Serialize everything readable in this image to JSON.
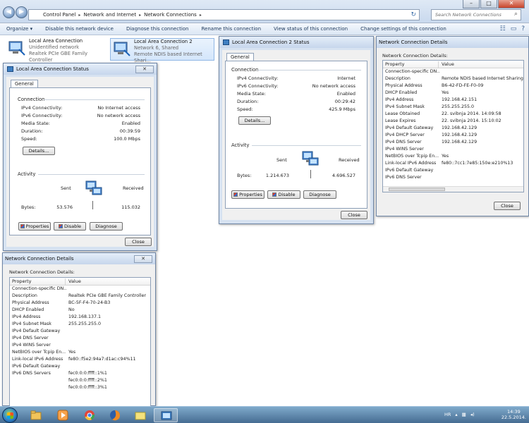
{
  "explorer": {
    "breadcrumb": [
      "Control Panel",
      "Network and Internet",
      "Network Connections"
    ],
    "search_placeholder": "Search Network Connections",
    "commands": [
      "Organize ▾",
      "Disable this network device",
      "Diagnose this connection",
      "Rename this connection",
      "View status of this connection",
      "Change settings of this connection"
    ],
    "connections": [
      {
        "name": "Local Area Connection",
        "status": "Unidentified network",
        "device": "Realtek PCIe GBE Family Controller"
      },
      {
        "name": "Local Area Connection 2",
        "status": "Network 6, Shared",
        "device": "Remote NDIS based Internet Shari..."
      }
    ]
  },
  "status1": {
    "title": "Local Area Connection Status",
    "tab": "General",
    "connection_label": "Connection",
    "rows": [
      {
        "label": "IPv4 Connectivity:",
        "value": "No Internet access"
      },
      {
        "label": "IPv6 Connectivity:",
        "value": "No network access"
      },
      {
        "label": "Media State:",
        "value": "Enabled"
      },
      {
        "label": "Duration:",
        "value": "00:39:59"
      },
      {
        "label": "Speed:",
        "value": "100.0 Mbps"
      }
    ],
    "details_button": "Details...",
    "activity_label": "Activity",
    "sent_label": "Sent",
    "received_label": "Received",
    "bytes_label": "Bytes:",
    "bytes_sent": "53.576",
    "bytes_received": "115.032",
    "buttons": [
      "Properties",
      "Disable",
      "Diagnose"
    ],
    "close": "Close"
  },
  "status2": {
    "title": "Local Area Connection 2 Status",
    "tab": "General",
    "connection_label": "Connection",
    "rows": [
      {
        "label": "IPv4 Connectivity:",
        "value": "Internet"
      },
      {
        "label": "IPv6 Connectivity:",
        "value": "No network access"
      },
      {
        "label": "Media State:",
        "value": "Enabled"
      },
      {
        "label": "Duration:",
        "value": "00:29:42"
      },
      {
        "label": "Speed:",
        "value": "425.9 Mbps"
      }
    ],
    "details_button": "Details...",
    "activity_label": "Activity",
    "sent_label": "Sent",
    "received_label": "Received",
    "bytes_label": "Bytes:",
    "bytes_sent": "1.214.673",
    "bytes_received": "4.696.527",
    "buttons": [
      "Properties",
      "Disable",
      "Diagnose"
    ],
    "close": "Close"
  },
  "details1": {
    "title": "Network Connection Details",
    "caption": "Network Connection Details:",
    "col_property": "Property",
    "col_value": "Value",
    "rows": [
      {
        "p": "Connection-specific DN...",
        "v": ""
      },
      {
        "p": "Description",
        "v": "Realtek PCIe GBE Family Controller"
      },
      {
        "p": "Physical Address",
        "v": "BC-5F-F4-70-24-B3"
      },
      {
        "p": "DHCP Enabled",
        "v": "No"
      },
      {
        "p": "IPv4 Address",
        "v": "192.168.137.1"
      },
      {
        "p": "IPv4 Subnet Mask",
        "v": "255.255.255.0"
      },
      {
        "p": "IPv4 Default Gateway",
        "v": ""
      },
      {
        "p": "IPv4 DNS Server",
        "v": ""
      },
      {
        "p": "IPv4 WINS Server",
        "v": ""
      },
      {
        "p": "NetBIOS over Tcpip En...",
        "v": "Yes"
      },
      {
        "p": "Link-local IPv6 Address",
        "v": "fe80::f5e2:94a7:d1ac:c94%11"
      },
      {
        "p": "IPv6 Default Gateway",
        "v": ""
      },
      {
        "p": "IPv6 DNS Servers",
        "v": "fec0:0:0:ffff::1%1"
      },
      {
        "p": "",
        "v": "fec0:0:0:ffff::2%1"
      },
      {
        "p": "",
        "v": "fec0:0:0:ffff::3%1"
      }
    ]
  },
  "details2": {
    "title": "Network Connection Details",
    "caption": "Network Connection Details:",
    "col_property": "Property",
    "col_value": "Value",
    "rows": [
      {
        "p": "Connection-specific DN...",
        "v": ""
      },
      {
        "p": "Description",
        "v": "Remote NDIS based Internet Sharing De"
      },
      {
        "p": "Physical Address",
        "v": "B6-42-FD-FE-F0-09"
      },
      {
        "p": "DHCP Enabled",
        "v": "Yes"
      },
      {
        "p": "IPv4 Address",
        "v": "192.168.42.151"
      },
      {
        "p": "IPv4 Subnet Mask",
        "v": "255.255.255.0"
      },
      {
        "p": "Lease Obtained",
        "v": "22. svibnja 2014. 14:09:58"
      },
      {
        "p": "Lease Expires",
        "v": "22. svibnja 2014. 15:10:02"
      },
      {
        "p": "IPv4 Default Gateway",
        "v": "192.168.42.129"
      },
      {
        "p": "IPv4 DHCP Server",
        "v": "192.168.42.129"
      },
      {
        "p": "IPv4 DNS Server",
        "v": "192.168.42.129"
      },
      {
        "p": "IPv4 WINS Server",
        "v": ""
      },
      {
        "p": "NetBIOS over Tcpip En...",
        "v": "Yes"
      },
      {
        "p": "Link-local IPv6 Address",
        "v": "fe80::7cc1:7e85:150e:e210%13"
      },
      {
        "p": "IPv6 Default Gateway",
        "v": ""
      },
      {
        "p": "IPv6 DNS Server",
        "v": ""
      }
    ],
    "close": "Close"
  },
  "taskbar": {
    "language": "HR",
    "time": "14:39",
    "date": "22.5.2014."
  }
}
